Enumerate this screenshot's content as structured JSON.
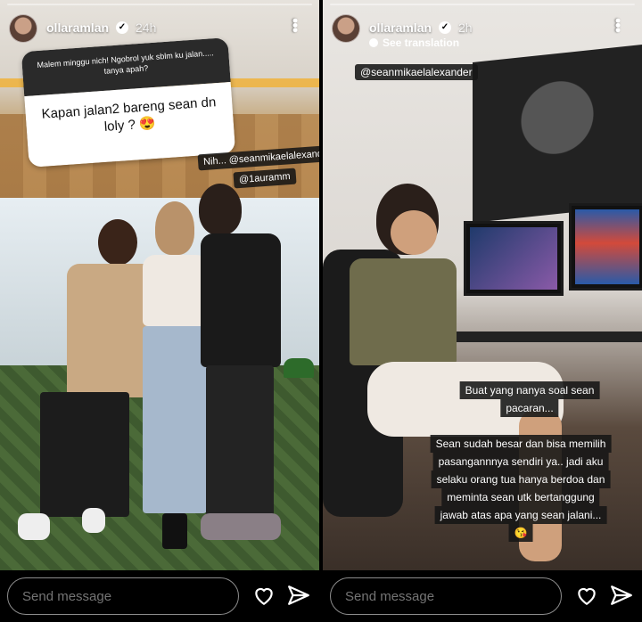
{
  "left_story": {
    "username": "ollaramlan",
    "time": "24h",
    "question": {
      "prompt": "Malem minggu nich! Ngobrol yuk sblm ku jalan..... tanya apah?",
      "answer": "Kapan jalan2 bareng sean dn loly ? 😍"
    },
    "tags": [
      "Nih... @seanmikaelalexander",
      "@1auramm"
    ],
    "footer": {
      "placeholder": "Send message"
    }
  },
  "right_story": {
    "username": "ollaramlan",
    "time": "2h",
    "translate_label": "See translation",
    "mention": "@seanmikaelalexander",
    "caption_lines": [
      "Buat yang nanya soal sean",
      "pacaran...",
      "",
      "Sean sudah besar dan bisa memilih",
      "pasangannnya sendiri ya.. jadi aku",
      "selaku orang tua hanya berdoa dan",
      "meminta sean utk bertanggung",
      "jawab atas apa yang sean jalani...",
      "😘"
    ],
    "footer": {
      "placeholder": "Send message"
    }
  },
  "icons": {
    "verified": "verified-badge-icon",
    "more": "more-options-icon",
    "like": "heart-icon",
    "share": "send-icon"
  }
}
